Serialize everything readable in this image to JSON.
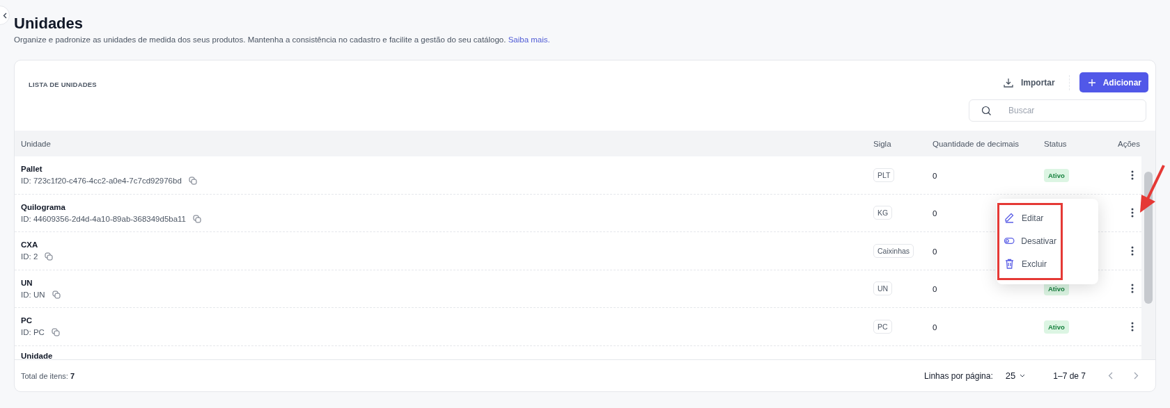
{
  "page": {
    "title": "Unidades",
    "description": "Organize e padronize as unidades de medida dos seus produtos. Mantenha a consistência no cadastro e facilite a gestão do seu catálogo.",
    "link": "Saiba mais."
  },
  "card": {
    "title": "LISTA DE UNIDADES",
    "import_button": "Importar",
    "add_button": "Adicionar",
    "search": {
      "placeholder": "Buscar"
    }
  },
  "table": {
    "columns": [
      "Unidade",
      "Sigla",
      "Quantidade de decimais",
      "Status",
      "Ações"
    ],
    "rows": [
      {
        "name": "Pallet",
        "id": "ID: 723c1f20-c476-4cc2-a0e4-7c7cd92976bd",
        "sigla": "PLT",
        "decimals": "0",
        "status": "Ativo"
      },
      {
        "name": "Quilograma",
        "id": "ID: 44609356-2d4d-4a10-89ab-368349d5ba11",
        "sigla": "KG",
        "decimals": "0",
        "menu_open": true
      },
      {
        "name": "CXA",
        "id": "ID: 2",
        "sigla": "Caixinhas",
        "decimals": "0"
      },
      {
        "name": "UN",
        "id": "ID: UN",
        "sigla": "UN",
        "decimals": "0",
        "status": "Ativo"
      },
      {
        "name": "PC",
        "id": "ID: PC",
        "sigla": "PC",
        "decimals": "0",
        "status": "Ativo"
      },
      {
        "name": "Unidade"
      }
    ]
  },
  "action_menu": {
    "items": [
      {
        "kind": "edit",
        "label": "Editar"
      },
      {
        "kind": "toggle",
        "label": "Desativar"
      },
      {
        "kind": "delete",
        "label": "Excluir"
      }
    ]
  },
  "footer": {
    "total_label": "Total de itens:",
    "total": "7",
    "rows_label": "Linhas por página:",
    "rows_per_page": "25",
    "range": "1–7 de 7"
  }
}
